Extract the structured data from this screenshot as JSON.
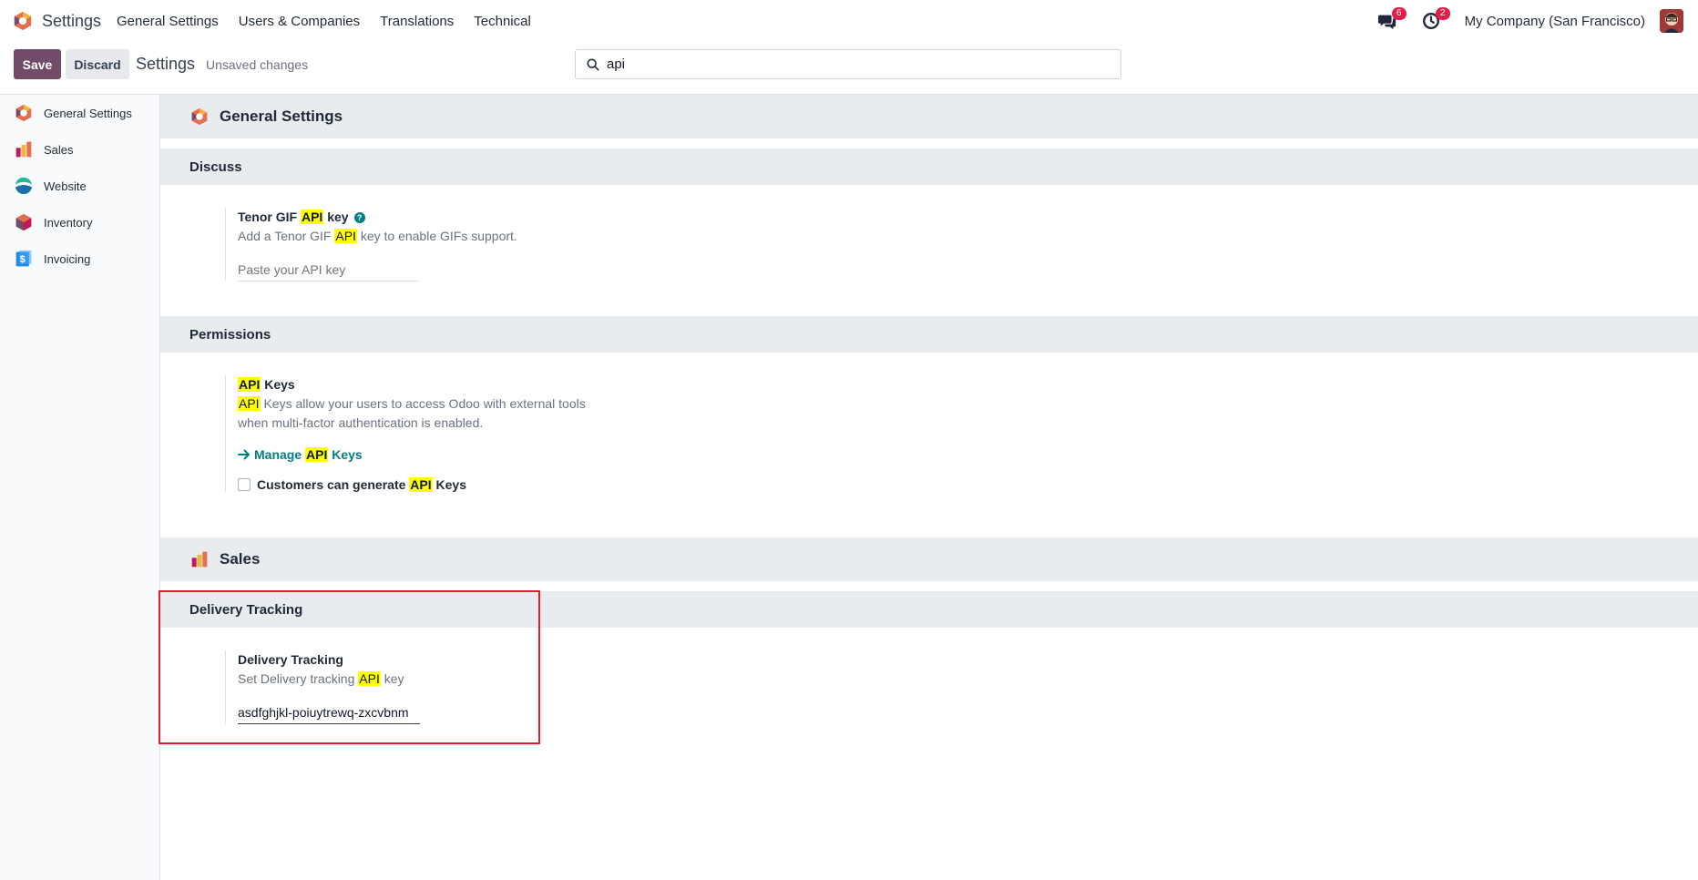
{
  "navbar": {
    "app_name": "Settings",
    "menu": [
      "General Settings",
      "Users & Companies",
      "Translations",
      "Technical"
    ],
    "messages_count": "6",
    "activities_count": "2",
    "company": "My Company (San Francisco)"
  },
  "control_panel": {
    "save_label": "Save",
    "discard_label": "Discard",
    "title": "Settings",
    "status": "Unsaved changes",
    "search_value": "api"
  },
  "sidebar": {
    "items": [
      {
        "label": "General Settings",
        "icon": "odoo-logo-icon"
      },
      {
        "label": "Sales",
        "icon": "sales-chart-icon"
      },
      {
        "label": "Website",
        "icon": "website-icon"
      },
      {
        "label": "Inventory",
        "icon": "inventory-box-icon"
      },
      {
        "label": "Invoicing",
        "icon": "invoicing-icon"
      }
    ]
  },
  "general": {
    "app_title": "General Settings",
    "discuss": {
      "section_title": "Discuss",
      "setting_title_pre": "Tenor GIF ",
      "setting_title_hl": "API",
      "setting_title_post": " key",
      "desc_pre": "Add a Tenor GIF ",
      "desc_hl": "API",
      "desc_post": " key to enable GIFs support.",
      "input_placeholder": "Paste your API key"
    },
    "permissions": {
      "section_title": "Permissions",
      "setting_title_hl": "API",
      "setting_title_post": " Keys",
      "desc_hl": "API",
      "desc_line1_post": " Keys allow your users to access Odoo with external tools",
      "desc_line2": "when multi-factor authentication is enabled.",
      "link_pre": "Manage ",
      "link_hl": "API",
      "link_post": " Keys",
      "checkbox_pre": "Customers can generate ",
      "checkbox_hl": "API",
      "checkbox_post": " Keys"
    }
  },
  "sales": {
    "app_title": "Sales",
    "delivery": {
      "section_title": "Delivery Tracking",
      "setting_title": "Delivery Tracking",
      "desc_pre": "Set Delivery tracking ",
      "desc_hl": "API",
      "desc_post": " key",
      "input_value": "asdfghjkl-poiuytrewq-zxcvbnm"
    }
  },
  "colors": {
    "brand": "#714b67",
    "link": "#017e84",
    "highlight": "#ffff00",
    "badge": "#e11d48",
    "annotation": "#e11d2f"
  }
}
